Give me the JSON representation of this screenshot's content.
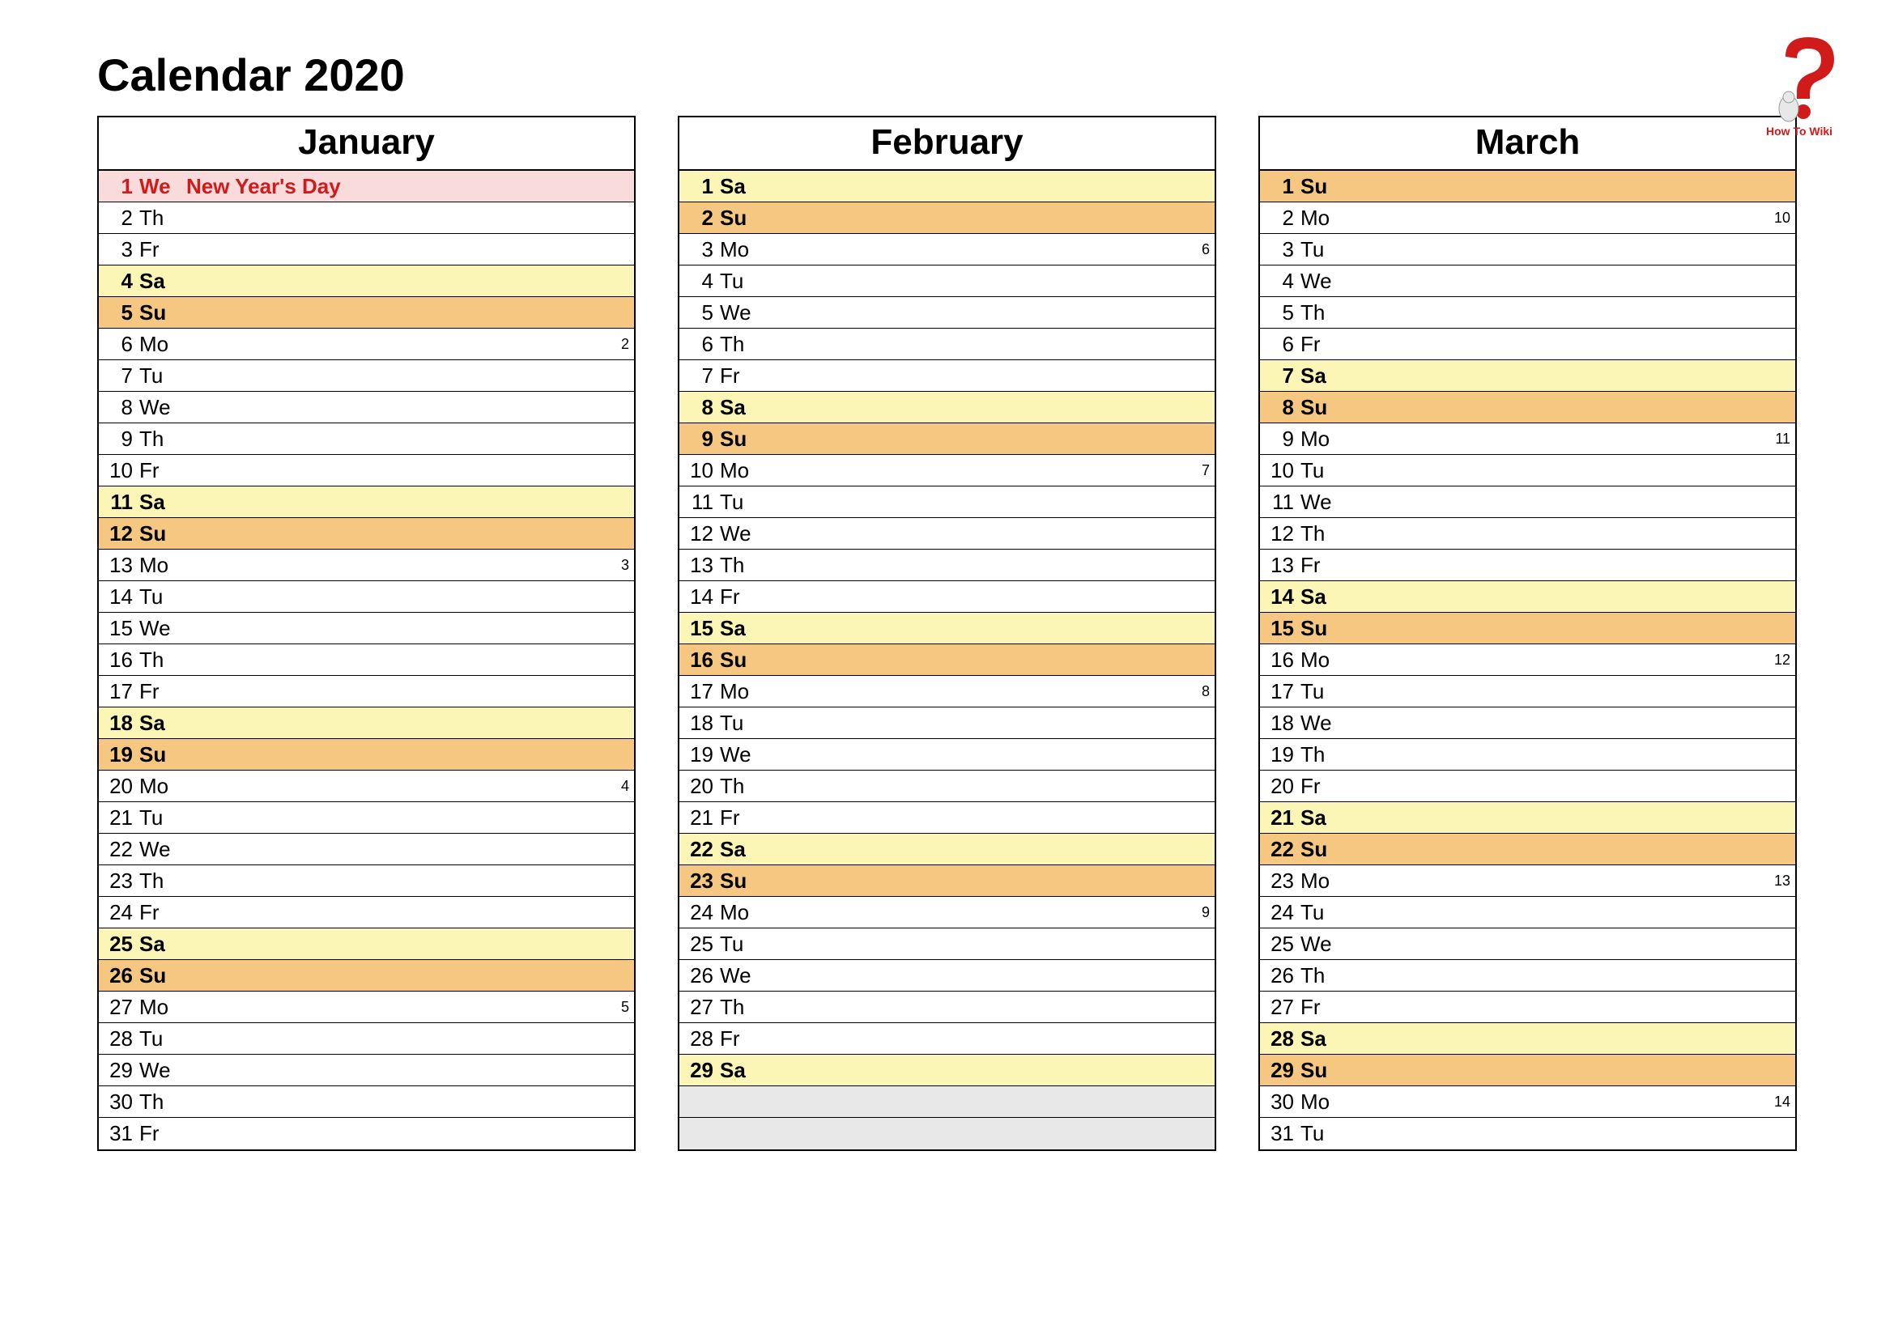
{
  "title": "Calendar 2020",
  "logo_text": "How To Wiki",
  "months": [
    {
      "name": "January",
      "days": [
        {
          "num": "1",
          "dow": "We",
          "event": "New Year's Day",
          "cls": "holiday",
          "week": ""
        },
        {
          "num": "2",
          "dow": "Th",
          "event": "",
          "cls": "",
          "week": ""
        },
        {
          "num": "3",
          "dow": "Fr",
          "event": "",
          "cls": "",
          "week": ""
        },
        {
          "num": "4",
          "dow": "Sa",
          "event": "",
          "cls": "sat",
          "week": ""
        },
        {
          "num": "5",
          "dow": "Su",
          "event": "",
          "cls": "sun",
          "week": ""
        },
        {
          "num": "6",
          "dow": "Mo",
          "event": "",
          "cls": "",
          "week": "2"
        },
        {
          "num": "7",
          "dow": "Tu",
          "event": "",
          "cls": "",
          "week": ""
        },
        {
          "num": "8",
          "dow": "We",
          "event": "",
          "cls": "",
          "week": ""
        },
        {
          "num": "9",
          "dow": "Th",
          "event": "",
          "cls": "",
          "week": ""
        },
        {
          "num": "10",
          "dow": "Fr",
          "event": "",
          "cls": "",
          "week": ""
        },
        {
          "num": "11",
          "dow": "Sa",
          "event": "",
          "cls": "sat",
          "week": ""
        },
        {
          "num": "12",
          "dow": "Su",
          "event": "",
          "cls": "sun",
          "week": ""
        },
        {
          "num": "13",
          "dow": "Mo",
          "event": "",
          "cls": "",
          "week": "3"
        },
        {
          "num": "14",
          "dow": "Tu",
          "event": "",
          "cls": "",
          "week": ""
        },
        {
          "num": "15",
          "dow": "We",
          "event": "",
          "cls": "",
          "week": ""
        },
        {
          "num": "16",
          "dow": "Th",
          "event": "",
          "cls": "",
          "week": ""
        },
        {
          "num": "17",
          "dow": "Fr",
          "event": "",
          "cls": "",
          "week": ""
        },
        {
          "num": "18",
          "dow": "Sa",
          "event": "",
          "cls": "sat",
          "week": ""
        },
        {
          "num": "19",
          "dow": "Su",
          "event": "",
          "cls": "sun",
          "week": ""
        },
        {
          "num": "20",
          "dow": "Mo",
          "event": "",
          "cls": "",
          "week": "4"
        },
        {
          "num": "21",
          "dow": "Tu",
          "event": "",
          "cls": "",
          "week": ""
        },
        {
          "num": "22",
          "dow": "We",
          "event": "",
          "cls": "",
          "week": ""
        },
        {
          "num": "23",
          "dow": "Th",
          "event": "",
          "cls": "",
          "week": ""
        },
        {
          "num": "24",
          "dow": "Fr",
          "event": "",
          "cls": "",
          "week": ""
        },
        {
          "num": "25",
          "dow": "Sa",
          "event": "",
          "cls": "sat",
          "week": ""
        },
        {
          "num": "26",
          "dow": "Su",
          "event": "",
          "cls": "sun",
          "week": ""
        },
        {
          "num": "27",
          "dow": "Mo",
          "event": "",
          "cls": "",
          "week": "5"
        },
        {
          "num": "28",
          "dow": "Tu",
          "event": "",
          "cls": "",
          "week": ""
        },
        {
          "num": "29",
          "dow": "We",
          "event": "",
          "cls": "",
          "week": ""
        },
        {
          "num": "30",
          "dow": "Th",
          "event": "",
          "cls": "",
          "week": ""
        },
        {
          "num": "31",
          "dow": "Fr",
          "event": "",
          "cls": "",
          "week": ""
        }
      ]
    },
    {
      "name": "February",
      "days": [
        {
          "num": "1",
          "dow": "Sa",
          "event": "",
          "cls": "sat",
          "week": ""
        },
        {
          "num": "2",
          "dow": "Su",
          "event": "",
          "cls": "sun",
          "week": ""
        },
        {
          "num": "3",
          "dow": "Mo",
          "event": "",
          "cls": "",
          "week": "6"
        },
        {
          "num": "4",
          "dow": "Tu",
          "event": "",
          "cls": "",
          "week": ""
        },
        {
          "num": "5",
          "dow": "We",
          "event": "",
          "cls": "",
          "week": ""
        },
        {
          "num": "6",
          "dow": "Th",
          "event": "",
          "cls": "",
          "week": ""
        },
        {
          "num": "7",
          "dow": "Fr",
          "event": "",
          "cls": "",
          "week": ""
        },
        {
          "num": "8",
          "dow": "Sa",
          "event": "",
          "cls": "sat",
          "week": ""
        },
        {
          "num": "9",
          "dow": "Su",
          "event": "",
          "cls": "sun",
          "week": ""
        },
        {
          "num": "10",
          "dow": "Mo",
          "event": "",
          "cls": "",
          "week": "7"
        },
        {
          "num": "11",
          "dow": "Tu",
          "event": "",
          "cls": "",
          "week": ""
        },
        {
          "num": "12",
          "dow": "We",
          "event": "",
          "cls": "",
          "week": ""
        },
        {
          "num": "13",
          "dow": "Th",
          "event": "",
          "cls": "",
          "week": ""
        },
        {
          "num": "14",
          "dow": "Fr",
          "event": "",
          "cls": "",
          "week": ""
        },
        {
          "num": "15",
          "dow": "Sa",
          "event": "",
          "cls": "sat",
          "week": ""
        },
        {
          "num": "16",
          "dow": "Su",
          "event": "",
          "cls": "sun",
          "week": ""
        },
        {
          "num": "17",
          "dow": "Mo",
          "event": "",
          "cls": "",
          "week": "8"
        },
        {
          "num": "18",
          "dow": "Tu",
          "event": "",
          "cls": "",
          "week": ""
        },
        {
          "num": "19",
          "dow": "We",
          "event": "",
          "cls": "",
          "week": ""
        },
        {
          "num": "20",
          "dow": "Th",
          "event": "",
          "cls": "",
          "week": ""
        },
        {
          "num": "21",
          "dow": "Fr",
          "event": "",
          "cls": "",
          "week": ""
        },
        {
          "num": "22",
          "dow": "Sa",
          "event": "",
          "cls": "sat",
          "week": ""
        },
        {
          "num": "23",
          "dow": "Su",
          "event": "",
          "cls": "sun",
          "week": ""
        },
        {
          "num": "24",
          "dow": "Mo",
          "event": "",
          "cls": "",
          "week": "9"
        },
        {
          "num": "25",
          "dow": "Tu",
          "event": "",
          "cls": "",
          "week": ""
        },
        {
          "num": "26",
          "dow": "We",
          "event": "",
          "cls": "",
          "week": ""
        },
        {
          "num": "27",
          "dow": "Th",
          "event": "",
          "cls": "",
          "week": ""
        },
        {
          "num": "28",
          "dow": "Fr",
          "event": "",
          "cls": "",
          "week": ""
        },
        {
          "num": "29",
          "dow": "Sa",
          "event": "",
          "cls": "sat",
          "week": ""
        },
        {
          "num": "",
          "dow": "",
          "event": "",
          "cls": "empty",
          "week": ""
        },
        {
          "num": "",
          "dow": "",
          "event": "",
          "cls": "empty",
          "week": ""
        }
      ]
    },
    {
      "name": "March",
      "days": [
        {
          "num": "1",
          "dow": "Su",
          "event": "",
          "cls": "sun",
          "week": ""
        },
        {
          "num": "2",
          "dow": "Mo",
          "event": "",
          "cls": "",
          "week": "10"
        },
        {
          "num": "3",
          "dow": "Tu",
          "event": "",
          "cls": "",
          "week": ""
        },
        {
          "num": "4",
          "dow": "We",
          "event": "",
          "cls": "",
          "week": ""
        },
        {
          "num": "5",
          "dow": "Th",
          "event": "",
          "cls": "",
          "week": ""
        },
        {
          "num": "6",
          "dow": "Fr",
          "event": "",
          "cls": "",
          "week": ""
        },
        {
          "num": "7",
          "dow": "Sa",
          "event": "",
          "cls": "sat",
          "week": ""
        },
        {
          "num": "8",
          "dow": "Su",
          "event": "",
          "cls": "sun",
          "week": ""
        },
        {
          "num": "9",
          "dow": "Mo",
          "event": "",
          "cls": "",
          "week": "11"
        },
        {
          "num": "10",
          "dow": "Tu",
          "event": "",
          "cls": "",
          "week": ""
        },
        {
          "num": "11",
          "dow": "We",
          "event": "",
          "cls": "",
          "week": ""
        },
        {
          "num": "12",
          "dow": "Th",
          "event": "",
          "cls": "",
          "week": ""
        },
        {
          "num": "13",
          "dow": "Fr",
          "event": "",
          "cls": "",
          "week": ""
        },
        {
          "num": "14",
          "dow": "Sa",
          "event": "",
          "cls": "sat",
          "week": ""
        },
        {
          "num": "15",
          "dow": "Su",
          "event": "",
          "cls": "sun",
          "week": ""
        },
        {
          "num": "16",
          "dow": "Mo",
          "event": "",
          "cls": "",
          "week": "12"
        },
        {
          "num": "17",
          "dow": "Tu",
          "event": "",
          "cls": "",
          "week": ""
        },
        {
          "num": "18",
          "dow": "We",
          "event": "",
          "cls": "",
          "week": ""
        },
        {
          "num": "19",
          "dow": "Th",
          "event": "",
          "cls": "",
          "week": ""
        },
        {
          "num": "20",
          "dow": "Fr",
          "event": "",
          "cls": "",
          "week": ""
        },
        {
          "num": "21",
          "dow": "Sa",
          "event": "",
          "cls": "sat",
          "week": ""
        },
        {
          "num": "22",
          "dow": "Su",
          "event": "",
          "cls": "sun",
          "week": ""
        },
        {
          "num": "23",
          "dow": "Mo",
          "event": "",
          "cls": "",
          "week": "13"
        },
        {
          "num": "24",
          "dow": "Tu",
          "event": "",
          "cls": "",
          "week": ""
        },
        {
          "num": "25",
          "dow": "We",
          "event": "",
          "cls": "",
          "week": ""
        },
        {
          "num": "26",
          "dow": "Th",
          "event": "",
          "cls": "",
          "week": ""
        },
        {
          "num": "27",
          "dow": "Fr",
          "event": "",
          "cls": "",
          "week": ""
        },
        {
          "num": "28",
          "dow": "Sa",
          "event": "",
          "cls": "sat",
          "week": ""
        },
        {
          "num": "29",
          "dow": "Su",
          "event": "",
          "cls": "sun",
          "week": ""
        },
        {
          "num": "30",
          "dow": "Mo",
          "event": "",
          "cls": "",
          "week": "14"
        },
        {
          "num": "31",
          "dow": "Tu",
          "event": "",
          "cls": "",
          "week": ""
        }
      ]
    }
  ]
}
